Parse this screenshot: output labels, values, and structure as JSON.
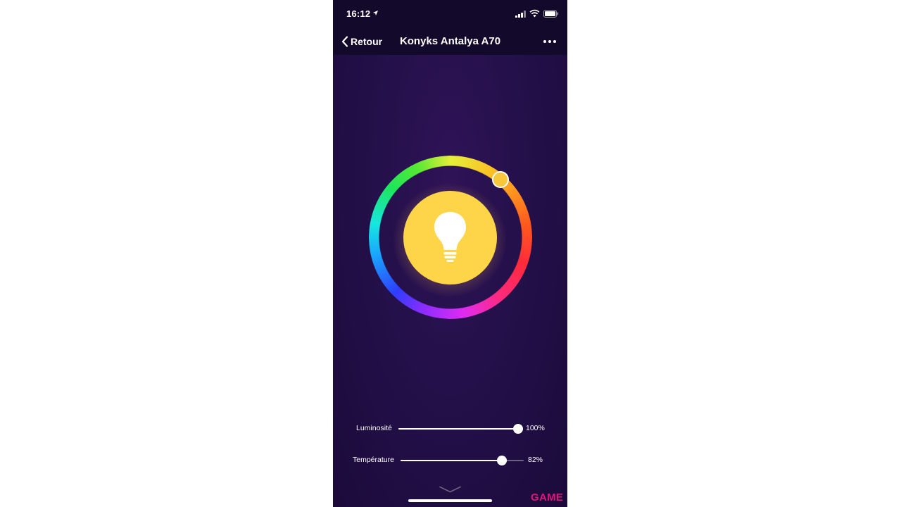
{
  "status_bar": {
    "time": "16:12"
  },
  "nav": {
    "back_label": "Retour",
    "title": "Konyks Antalya A70"
  },
  "sliders": [
    {
      "label": "Luminosité",
      "value_text": "100%",
      "fraction": 1.0
    },
    {
      "label": "Température",
      "value_text": "82%",
      "fraction": 0.82
    }
  ],
  "watermark": "GAME",
  "icons": [
    "location-arrow-icon",
    "cellular-signal-icon",
    "wifi-icon",
    "battery-icon",
    "chevron-left-icon",
    "more-icon",
    "bulb-icon",
    "chevron-down-icon"
  ],
  "colors": {
    "selected_color": "#f7c83b",
    "bulb_fill": "#fed549",
    "background": "#24104a",
    "watermark": "#e0147a"
  }
}
